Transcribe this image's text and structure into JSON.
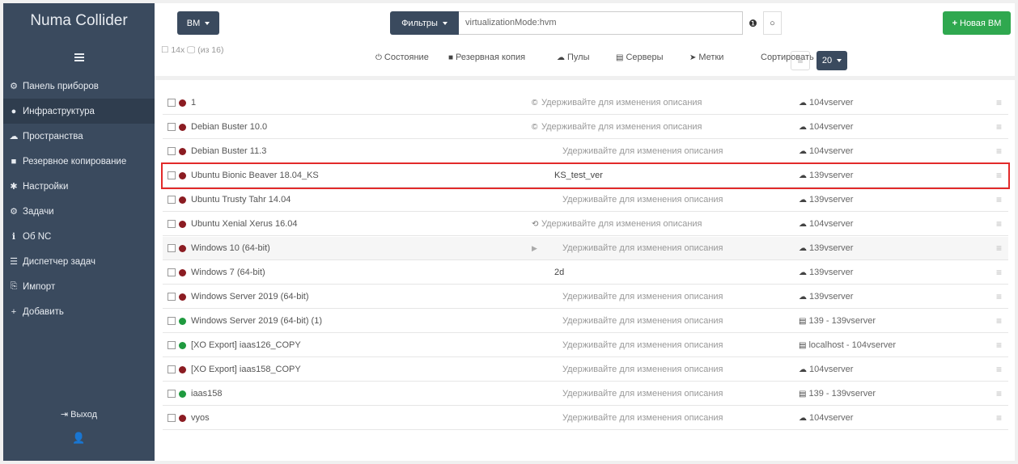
{
  "app": {
    "title": "Numa Collider"
  },
  "sidebar": {
    "items": [
      {
        "label": "Панель приборов",
        "icon": "dashboard-icon",
        "glyph": "⚙"
      },
      {
        "label": "Инфраструктура",
        "icon": "globe-icon",
        "glyph": "●"
      },
      {
        "label": "Пространства",
        "icon": "cloud-icon",
        "glyph": "☁"
      },
      {
        "label": "Резервное копирование",
        "icon": "archive-icon",
        "glyph": "■"
      },
      {
        "label": "Настройки",
        "icon": "gear-icon",
        "glyph": "✱"
      },
      {
        "label": "Задачи",
        "icon": "cogs-icon",
        "glyph": "⚙"
      },
      {
        "label": "Об NC",
        "icon": "info-icon",
        "glyph": "ℹ"
      },
      {
        "label": "Диспетчер задач",
        "icon": "tasks-icon",
        "glyph": "☰"
      },
      {
        "label": "Импорт",
        "icon": "import-icon",
        "glyph": "⎘"
      },
      {
        "label": "Добавить",
        "icon": "plus-icon",
        "glyph": "+"
      }
    ],
    "active_index": 1,
    "logout_label": "Выход"
  },
  "toolbar": {
    "type_label": "ВМ",
    "filters_label": "Фильтры",
    "filter_value": "virtualizationMode:hvm",
    "new_vm_label": "Новая ВМ",
    "count_text": "☐ 14x 🖵 (из 16)",
    "tools": [
      {
        "label": "Состояние",
        "glyph": "⏻"
      },
      {
        "label": "Резервная копия",
        "glyph": "■"
      },
      {
        "label": "Пулы",
        "glyph": "☁"
      },
      {
        "label": "Серверы",
        "glyph": "▤"
      },
      {
        "label": "Метки",
        "glyph": "➤"
      }
    ],
    "sort_label": "Сортировать по",
    "page_size": "20"
  },
  "vms": [
    {
      "name": "1",
      "status": "red",
      "desc": "Удерживайте для изменения описания",
      "desc_icon": "©",
      "host": "104vserver",
      "host_type": "pool"
    },
    {
      "name": "Debian Buster 10.0",
      "status": "red",
      "desc": "Удерживайте для изменения описания",
      "desc_icon": "©",
      "host": "104vserver",
      "host_type": "pool"
    },
    {
      "name": "Debian Buster 11.3",
      "status": "red",
      "desc": "Удерживайте для изменения описания",
      "desc_icon": "",
      "host": "104vserver",
      "host_type": "pool"
    },
    {
      "name": "Ubuntu Bionic Beaver 18.04_KS",
      "status": "red",
      "desc": "KS_test_ver",
      "desc_icon": "",
      "host": "139vserver",
      "host_type": "pool",
      "highlight": true
    },
    {
      "name": "Ubuntu Trusty Tahr 14.04",
      "status": "red",
      "desc": "Удерживайте для изменения описания",
      "desc_icon": "",
      "host": "139vserver",
      "host_type": "pool"
    },
    {
      "name": "Ubuntu Xenial Xerus 16.04",
      "status": "red",
      "desc": "Удерживайте для изменения описания",
      "desc_icon": "⟲",
      "host": "104vserver",
      "host_type": "pool"
    },
    {
      "name": "Windows 10 (64-bit)",
      "status": "red",
      "desc": "Удерживайте для изменения описания",
      "desc_icon": "",
      "host": "139vserver",
      "host_type": "pool",
      "hover": true
    },
    {
      "name": "Windows 7 (64-bit)",
      "status": "red",
      "desc": "2d",
      "desc_icon": "",
      "host": "139vserver",
      "host_type": "pool"
    },
    {
      "name": "Windows Server 2019 (64-bit)",
      "status": "red",
      "desc": "Удерживайте для изменения описания",
      "desc_icon": "",
      "host": "139vserver",
      "host_type": "pool"
    },
    {
      "name": "Windows Server 2019 (64-bit) (1)",
      "status": "green",
      "desc": "Удерживайте для изменения описания",
      "desc_icon": "",
      "host": "139 - 139vserver",
      "host_type": "server"
    },
    {
      "name": "[XO Export] iaas126_COPY",
      "status": "green",
      "desc": "Удерживайте для изменения описания",
      "desc_icon": "",
      "host": "localhost - 104vserver",
      "host_type": "server"
    },
    {
      "name": "[XO Export] iaas158_COPY",
      "status": "red",
      "desc": "Удерживайте для изменения описания",
      "desc_icon": "",
      "host": "104vserver",
      "host_type": "pool"
    },
    {
      "name": "iaas158",
      "status": "green",
      "desc": "Удерживайте для изменения описания",
      "desc_icon": "",
      "host": "139 - 139vserver",
      "host_type": "server"
    },
    {
      "name": "vyos",
      "status": "red",
      "desc": "Удерживайте для изменения описания",
      "desc_icon": "",
      "host": "104vserver",
      "host_type": "pool"
    }
  ]
}
